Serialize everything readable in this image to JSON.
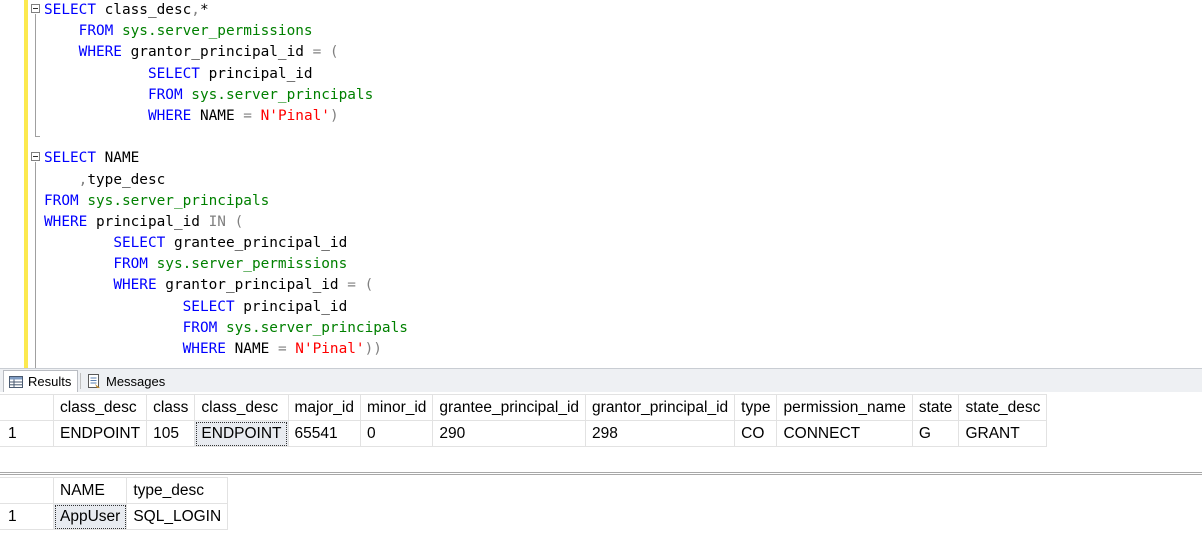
{
  "editor": {
    "lines": [
      [
        [
          "kw",
          "SELECT"
        ],
        [
          "t",
          " class_desc"
        ],
        [
          "op",
          ","
        ],
        [
          "t",
          "*"
        ]
      ],
      [
        [
          "t",
          "    "
        ],
        [
          "kw",
          "FROM"
        ],
        [
          "t",
          " "
        ],
        [
          "ob",
          "sys.server_permissions"
        ]
      ],
      [
        [
          "t",
          "    "
        ],
        [
          "kw",
          "WHERE"
        ],
        [
          "t",
          " grantor_principal_id "
        ],
        [
          "op",
          "= ("
        ]
      ],
      [
        [
          "t",
          "            "
        ],
        [
          "kw",
          "SELECT"
        ],
        [
          "t",
          " principal_id"
        ]
      ],
      [
        [
          "t",
          "            "
        ],
        [
          "kw",
          "FROM"
        ],
        [
          "t",
          " "
        ],
        [
          "ob",
          "sys.server_principals"
        ]
      ],
      [
        [
          "t",
          "            "
        ],
        [
          "kw",
          "WHERE"
        ],
        [
          "t",
          " NAME "
        ],
        [
          "op",
          "="
        ],
        [
          "t",
          " "
        ],
        [
          "str",
          "N'Pinal'"
        ],
        [
          "op",
          ")"
        ]
      ],
      [],
      [
        [
          "kw",
          "SELECT"
        ],
        [
          "t",
          " NAME"
        ]
      ],
      [
        [
          "t",
          "    "
        ],
        [
          "op",
          ","
        ],
        [
          "t",
          "type_desc"
        ]
      ],
      [
        [
          "kw",
          "FROM"
        ],
        [
          "t",
          " "
        ],
        [
          "ob",
          "sys.server_principals"
        ]
      ],
      [
        [
          "kw",
          "WHERE"
        ],
        [
          "t",
          " principal_id "
        ],
        [
          "op",
          "IN ("
        ]
      ],
      [
        [
          "t",
          "        "
        ],
        [
          "kw",
          "SELECT"
        ],
        [
          "t",
          " grantee_principal_id"
        ]
      ],
      [
        [
          "t",
          "        "
        ],
        [
          "kw",
          "FROM"
        ],
        [
          "t",
          " "
        ],
        [
          "ob",
          "sys.server_permissions"
        ]
      ],
      [
        [
          "t",
          "        "
        ],
        [
          "kw",
          "WHERE"
        ],
        [
          "t",
          " grantor_principal_id "
        ],
        [
          "op",
          "= ("
        ]
      ],
      [
        [
          "t",
          "                "
        ],
        [
          "kw",
          "SELECT"
        ],
        [
          "t",
          " principal_id"
        ]
      ],
      [
        [
          "t",
          "                "
        ],
        [
          "kw",
          "FROM"
        ],
        [
          "t",
          " "
        ],
        [
          "ob",
          "sys.server_principals"
        ]
      ],
      [
        [
          "t",
          "                "
        ],
        [
          "kw",
          "WHERE"
        ],
        [
          "t",
          " NAME "
        ],
        [
          "op",
          "="
        ],
        [
          "t",
          " "
        ],
        [
          "str",
          "N'Pinal'"
        ],
        [
          "op",
          "))"
        ]
      ]
    ]
  },
  "tabs": {
    "results_label": "Results",
    "messages_label": "Messages",
    "results_icon": "grid-icon",
    "messages_icon": "document-icon"
  },
  "grid1": {
    "columns": [
      "class_desc",
      "class",
      "class_desc",
      "major_id",
      "minor_id",
      "grantee_principal_id",
      "grantor_principal_id",
      "type",
      "permission_name",
      "state",
      "state_desc"
    ],
    "rows": [
      {
        "rownum": "1",
        "cells": [
          "ENDPOINT",
          "105",
          "ENDPOINT",
          "65541",
          "0",
          "290",
          "298",
          "CO",
          "CONNECT",
          "G",
          "GRANT"
        ]
      }
    ],
    "selected_cell": 2
  },
  "grid2": {
    "columns": [
      "NAME",
      "type_desc"
    ],
    "rows": [
      {
        "rownum": "1",
        "cells": [
          "AppUser",
          "SQL_LOGIN"
        ]
      }
    ],
    "selected_cell": 0
  },
  "colors": {
    "keyword": "#0000ff",
    "object": "#008000",
    "string": "#ff0000",
    "operator": "#808080",
    "change_bar": "#fce94f"
  }
}
